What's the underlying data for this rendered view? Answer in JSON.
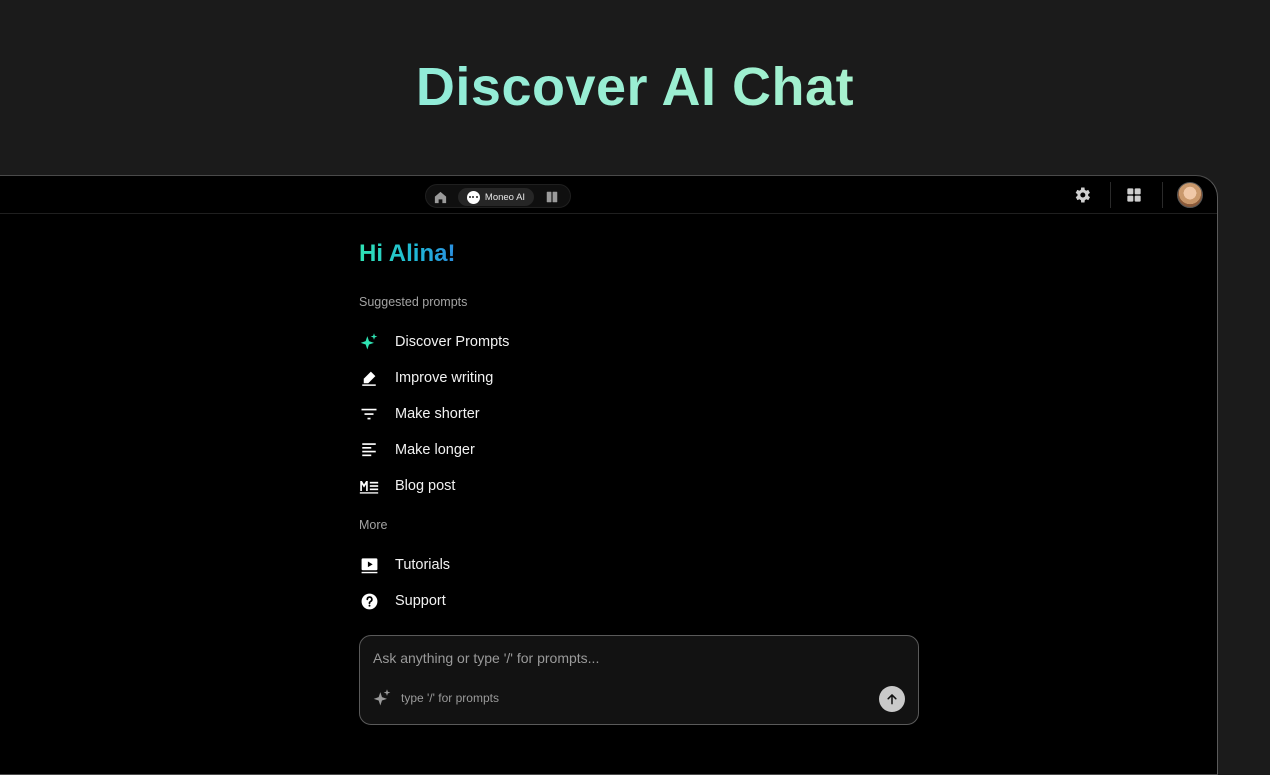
{
  "headline": "Discover AI Chat",
  "topbar": {
    "home_icon": "home-icon",
    "active_tab": {
      "label": "Moneo AI",
      "icon": "chat-bubble-icon"
    },
    "split_icon": "split-view-icon",
    "settings_icon": "gear-icon",
    "apps_icon": "grid-icon",
    "avatar": "user-avatar"
  },
  "greeting": "Hi Alina!",
  "suggested": {
    "title": "Suggested prompts",
    "items": [
      {
        "label": "Discover Prompts",
        "icon": "sparkle-icon"
      },
      {
        "label": "Improve writing",
        "icon": "pencil-icon"
      },
      {
        "label": "Make shorter",
        "icon": "filter-lines-icon"
      },
      {
        "label": "Make longer",
        "icon": "text-lines-icon"
      },
      {
        "label": "Blog post",
        "icon": "markdown-icon"
      }
    ]
  },
  "more": {
    "title": "More",
    "items": [
      {
        "label": "Tutorials",
        "icon": "video-play-icon"
      },
      {
        "label": "Support",
        "icon": "help-circle-icon"
      }
    ]
  },
  "composer": {
    "placeholder": "Ask anything or type '/' for prompts...",
    "hint": "type '/' for prompts",
    "send_icon": "arrow-up-icon"
  },
  "colors": {
    "accent_gradient_start": "#2fe3b3",
    "accent_gradient_end": "#2a8fe0",
    "headline_start": "#7fe6e4",
    "headline_end": "#c8f7c9"
  }
}
